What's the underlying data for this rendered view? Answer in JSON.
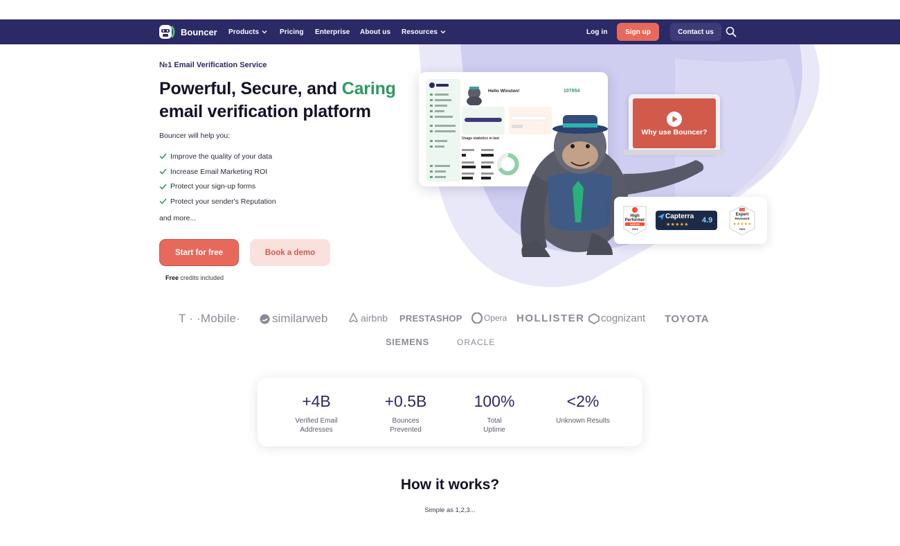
{
  "nav": {
    "brand": "Bouncer",
    "items": [
      {
        "label": "Products",
        "has_dropdown": true
      },
      {
        "label": "Pricing",
        "has_dropdown": false
      },
      {
        "label": "Enterprise",
        "has_dropdown": false
      },
      {
        "label": "About us",
        "has_dropdown": false
      },
      {
        "label": "Resources",
        "has_dropdown": true
      }
    ],
    "login": "Log in",
    "signup": "Sign up",
    "contact": "Contact us"
  },
  "hero": {
    "eyebrow": "№1 Email Verification Service",
    "title_part1": "Powerful, Secure, and ",
    "title_accent": "Caring",
    "title_part2": "email verification platform",
    "intro": "Bouncer will help you:",
    "benefits": [
      "Improve the quality of your data",
      "Increase Email Marketing ROI",
      "Protect your sign-up forms",
      "Protect your sender's Reputation"
    ],
    "more": "and more...",
    "cta_primary": "Start for free",
    "cta_secondary": "Book a demo",
    "credits_bold": "Free",
    "credits_rest": " credits included"
  },
  "visual": {
    "dashboard": {
      "brand": "Bouncer",
      "greeting": "Hello Winston!",
      "credits": "107854",
      "usage_title": "Usage statistics in last"
    },
    "video_cta": "Why use Bouncer?",
    "badges": {
      "g2_line1": "High",
      "g2_line2": "Performer",
      "g2_season": "WINTER",
      "g2_year": "2024",
      "capterra_name": "Capterra",
      "capterra_score": "4.9",
      "capterra_stars": "★★★★★",
      "expert_line1": "Expert",
      "expert_line2": "Reviewed",
      "expert_year": "2024"
    }
  },
  "logos": [
    "T · ·Mobile·",
    "similarweb",
    "airbnb",
    "PRESTASHOP",
    "Opera",
    "HOLLISTER",
    "cognizant",
    "TOYOTA",
    "SIEMENS",
    "ORACLE"
  ],
  "stats": [
    {
      "value": "+4B",
      "label": "Verified Email\nAddresses"
    },
    {
      "value": "+0.5B",
      "label": "Bounces\nPrevented"
    },
    {
      "value": "100%",
      "label": "Total\nUptime"
    },
    {
      "value": "<2%",
      "label": "Unknown Results"
    }
  ],
  "how": {
    "title": "How it works?",
    "subtitle": "Simple as 1,2,3..."
  },
  "colors": {
    "navy": "#2b2966",
    "coral": "#e7695c",
    "accent_green": "#2e9a60",
    "lavender": "#cfcdf0"
  }
}
